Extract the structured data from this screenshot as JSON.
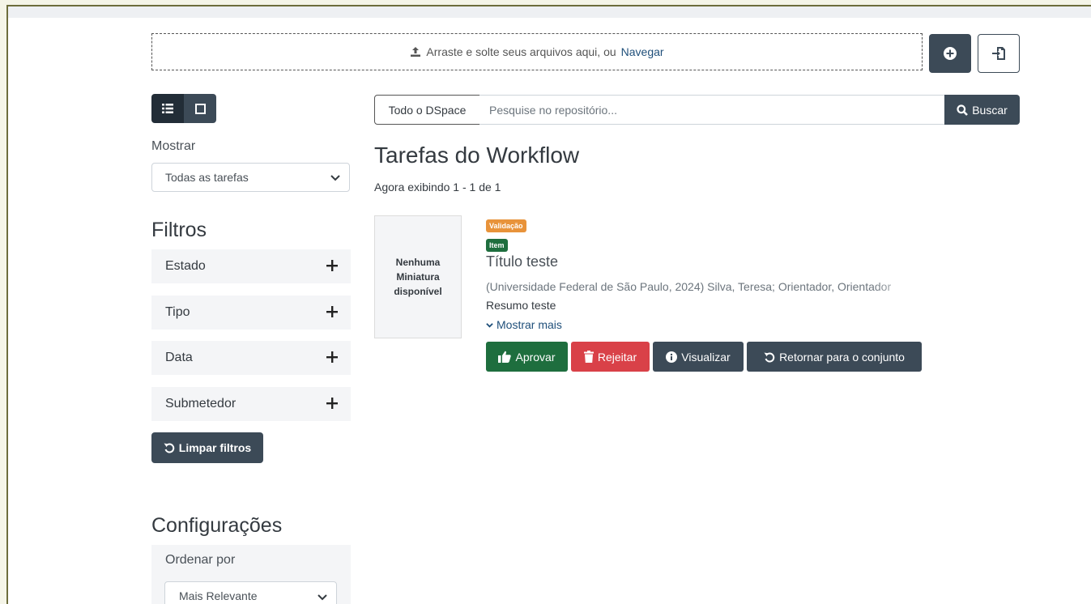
{
  "upload": {
    "drop_text": "Arraste e solte seus arquivos aqui, ou",
    "browse_label": "Navegar"
  },
  "icons": {
    "upload": "upload-icon",
    "add": "plus-circle-icon",
    "import": "import-icon",
    "list_view": "list-view-icon",
    "grid_view": "grid-view-icon",
    "search": "search-icon",
    "undo": "undo-icon",
    "thumbs_up": "thumbs-up-icon",
    "trash": "trash-icon",
    "info": "info-circle-icon",
    "chevron": "chevron-down-icon",
    "plus": "plus-icon"
  },
  "sidebar": {
    "show_label": "Mostrar",
    "show_select_value": "Todas as tarefas",
    "filters_heading": "Filtros",
    "filters": [
      {
        "label": "Estado"
      },
      {
        "label": "Tipo"
      },
      {
        "label": "Data"
      },
      {
        "label": "Submetedor"
      }
    ],
    "clear_filters_label": "Limpar filtros",
    "settings_heading": "Configurações",
    "sort_label": "Ordenar por",
    "sort_value": "Mais Relevante"
  },
  "search": {
    "scope_label": "Todo o DSpace",
    "placeholder": "Pesquise no repositório...",
    "button_label": "Buscar"
  },
  "main": {
    "title": "Tarefas do Workflow",
    "showing_text": "Agora exibindo 1 - 1 de 1",
    "result": {
      "thumbnail_text": "Nenhuma Miniatura disponível",
      "status_badge": "Validação",
      "type_badge": "Item",
      "title": "Título teste",
      "meta": "(Universidade Federal de São Paulo, 2024) Silva, Teresa; Orientador, Orientador",
      "abstract": "Resumo teste",
      "show_more": "Mostrar mais",
      "actions": {
        "approve": "Aprovar",
        "reject": "Rejeitar",
        "view": "Visualizar",
        "return": "Retornar para o conjunto"
      }
    }
  },
  "colors": {
    "primary_dark": "#3c4a57",
    "success": "#1e6e3e",
    "danger": "#d94148",
    "warning": "#e8933a",
    "link": "#1f4f7a"
  }
}
